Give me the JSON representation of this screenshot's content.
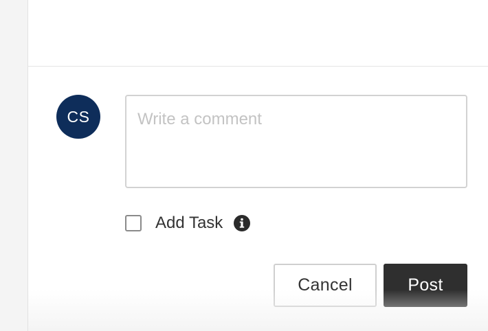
{
  "user": {
    "initials": "CS",
    "avatar_color": "#0e2d5a"
  },
  "comment": {
    "placeholder": "Write a comment",
    "value": ""
  },
  "task": {
    "label": "Add Task",
    "checked": false,
    "info_icon": "info-circle-icon"
  },
  "actions": {
    "cancel_label": "Cancel",
    "post_label": "Post",
    "post_color": "#2f2f2f"
  }
}
